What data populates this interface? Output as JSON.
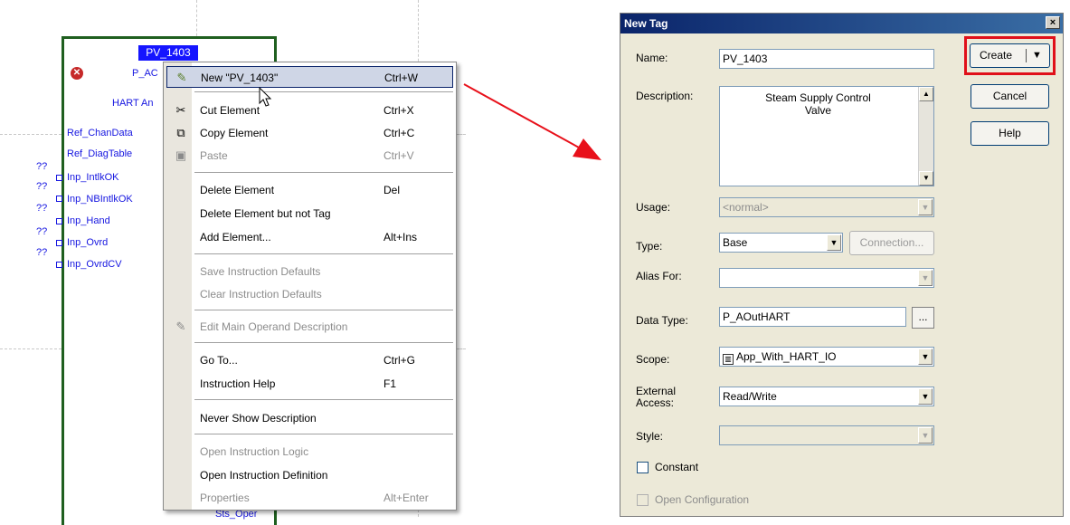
{
  "function_block": {
    "tag_name": "PV_1403",
    "pins": {
      "p_ac": "P_AC",
      "hart_an": "HART An",
      "ref_chandata": "Ref_ChanData",
      "ref_diagtable": "Ref_DiagTable",
      "inp_intlkok": "Inp_IntlkOK",
      "inp_nbintlkok": "Inp_NBIntlkOK",
      "inp_hand": "Inp_Hand",
      "inp_ovrd": "Inp_Ovrd",
      "inp_ovrdcv": "Inp_OvrdCV",
      "sts_oper": "Sts_Oper"
    },
    "unknown_marker": "??"
  },
  "context_menu": {
    "items": [
      {
        "label": "New \"PV_1403\"",
        "shortcut": "Ctrl+W",
        "icon": "new-tag-icon",
        "highlighted": true
      },
      {
        "label": "Cut Element",
        "shortcut": "Ctrl+X",
        "icon": "scissors-icon"
      },
      {
        "label": "Copy Element",
        "shortcut": "Ctrl+C",
        "icon": "copy-icon"
      },
      {
        "label": "Paste",
        "shortcut": "Ctrl+V",
        "icon": "paste-icon",
        "disabled": true
      },
      {
        "label": "Delete Element",
        "shortcut": "Del"
      },
      {
        "label": "Delete Element but not Tag",
        "shortcut": ""
      },
      {
        "label": "Add Element...",
        "shortcut": "Alt+Ins"
      },
      {
        "label": "Save Instruction Defaults",
        "shortcut": "",
        "disabled": true
      },
      {
        "label": "Clear Instruction Defaults",
        "shortcut": "",
        "disabled": true
      },
      {
        "label": "Edit Main Operand Description",
        "shortcut": "",
        "icon": "pencil-icon",
        "disabled": true
      },
      {
        "label": "Go To...",
        "shortcut": "Ctrl+G"
      },
      {
        "label": "Instruction Help",
        "shortcut": "F1"
      },
      {
        "label": "Never Show Description",
        "shortcut": ""
      },
      {
        "label": "Open Instruction Logic",
        "shortcut": "",
        "disabled": true
      },
      {
        "label": "Open Instruction Definition",
        "shortcut": ""
      },
      {
        "label": "Properties",
        "shortcut": "Alt+Enter",
        "disabled": true
      }
    ]
  },
  "dialog": {
    "title": "New Tag",
    "close_glyph": "×",
    "name_label": "Name:",
    "name_value": "PV_1403",
    "description_label": "Description:",
    "description_value": "Steam Supply Control\nValve",
    "usage_label": "Usage:",
    "usage_value": "<normal>",
    "type_label": "Type:",
    "type_value": "Base",
    "connection_button": "Connection...",
    "alias_label": "Alias For:",
    "alias_value": "",
    "data_type_label": "Data Type:",
    "data_type_value": "P_AOutHART",
    "browse_button": "...",
    "scope_label": "Scope:",
    "scope_value": "App_With_HART_IO",
    "external_access_label": "External\nAccess:",
    "external_access_value": "Read/Write",
    "style_label": "Style:",
    "style_value": "",
    "constant_label": "Constant",
    "open_config_label": "Open Configuration",
    "create_button": "Create",
    "cancel_button": "Cancel",
    "help_button": "Help",
    "highlight_color": "#e0101a"
  },
  "arrow_color": "#e8101a"
}
